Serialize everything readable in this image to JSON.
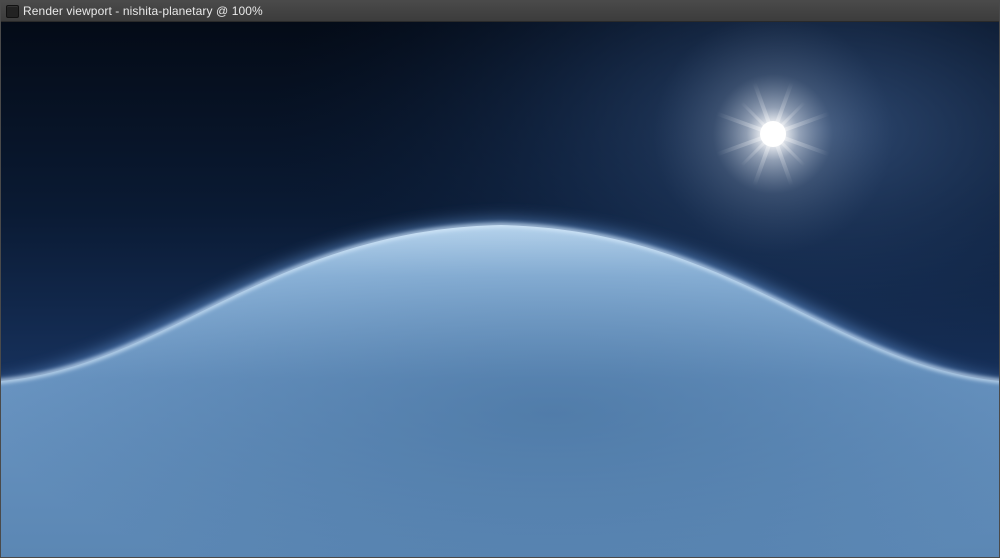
{
  "window": {
    "title": "Render viewport - nishita-planetary @ 100%",
    "icon": "window-icon"
  },
  "viewport": {
    "scene": "nishita-planetary",
    "zoom": "100%",
    "colors": {
      "space_top": "#040b17",
      "space_horizon": "#183055",
      "atmosphere_glow": "#7fb2ee",
      "planet_surface_light": "#a9c9e4",
      "planet_surface_mid": "#5f8fbd",
      "planet_surface_dark": "#4e7aa6",
      "sun_core": "#ffffff"
    }
  }
}
